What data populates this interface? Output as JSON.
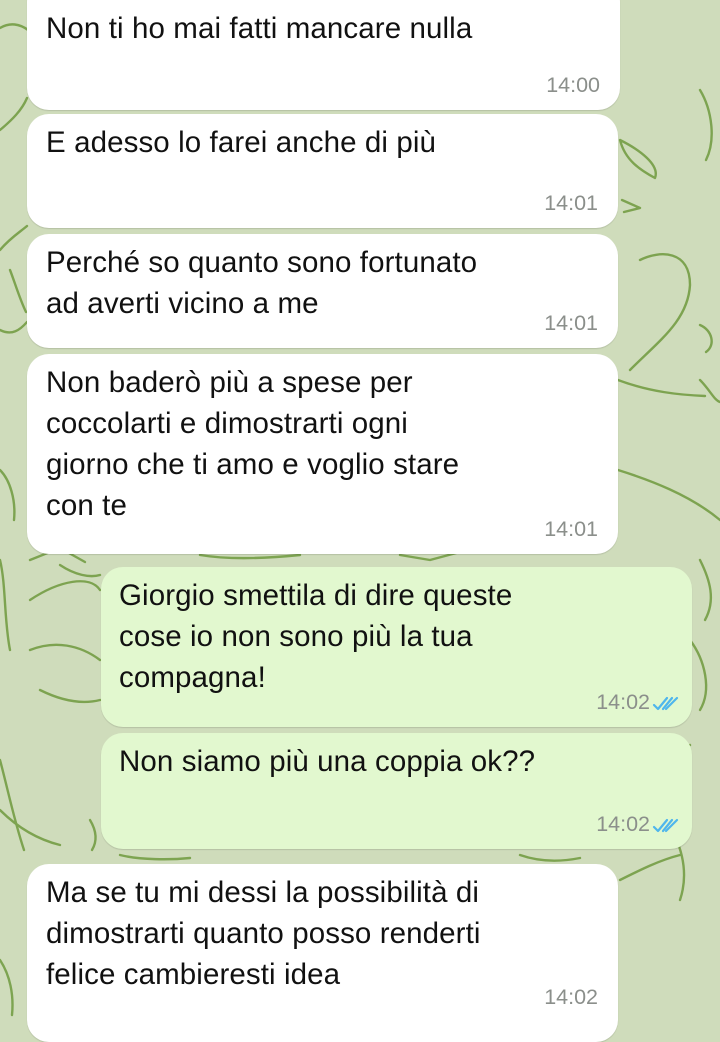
{
  "colors": {
    "wallpaper": "#cfdcbb",
    "wallpaper_doodle": "#6f9a3e",
    "incoming_bubble": "#ffffff",
    "outgoing_bubble": "#e2f8cf",
    "timestamp": "#8b8f8b",
    "read_ticks": "#4fb6ec"
  },
  "messages": [
    {
      "direction": "incoming",
      "lines": [
        "Non ti ho mai fatti mancare nulla"
      ],
      "time": "14:00"
    },
    {
      "direction": "incoming",
      "lines": [
        "E adesso lo farei anche di più"
      ],
      "time": "14:01"
    },
    {
      "direction": "incoming",
      "lines": [
        "Perché so quanto sono fortunato",
        "ad averti vicino a me"
      ],
      "time": "14:01"
    },
    {
      "direction": "incoming",
      "lines": [
        "Non baderò più a spese per",
        "coccolarti e dimostrarti ogni",
        "giorno che ti amo e voglio stare",
        "con te"
      ],
      "time": "14:01"
    },
    {
      "direction": "outgoing",
      "lines": [
        "Giorgio smettila di dire queste",
        "cose io non sono più la tua",
        "compagna!"
      ],
      "time": "14:02",
      "status_icon": "double-check-read-icon"
    },
    {
      "direction": "outgoing",
      "lines": [
        "Non siamo più una coppia ok??"
      ],
      "time": "14:02",
      "status_icon": "double-check-read-icon"
    },
    {
      "direction": "incoming",
      "lines": [
        "Ma se tu mi dessi la possibilità di",
        "dimostrarti quanto posso renderti",
        "felice cambieresti idea"
      ],
      "time": "14:02"
    }
  ]
}
